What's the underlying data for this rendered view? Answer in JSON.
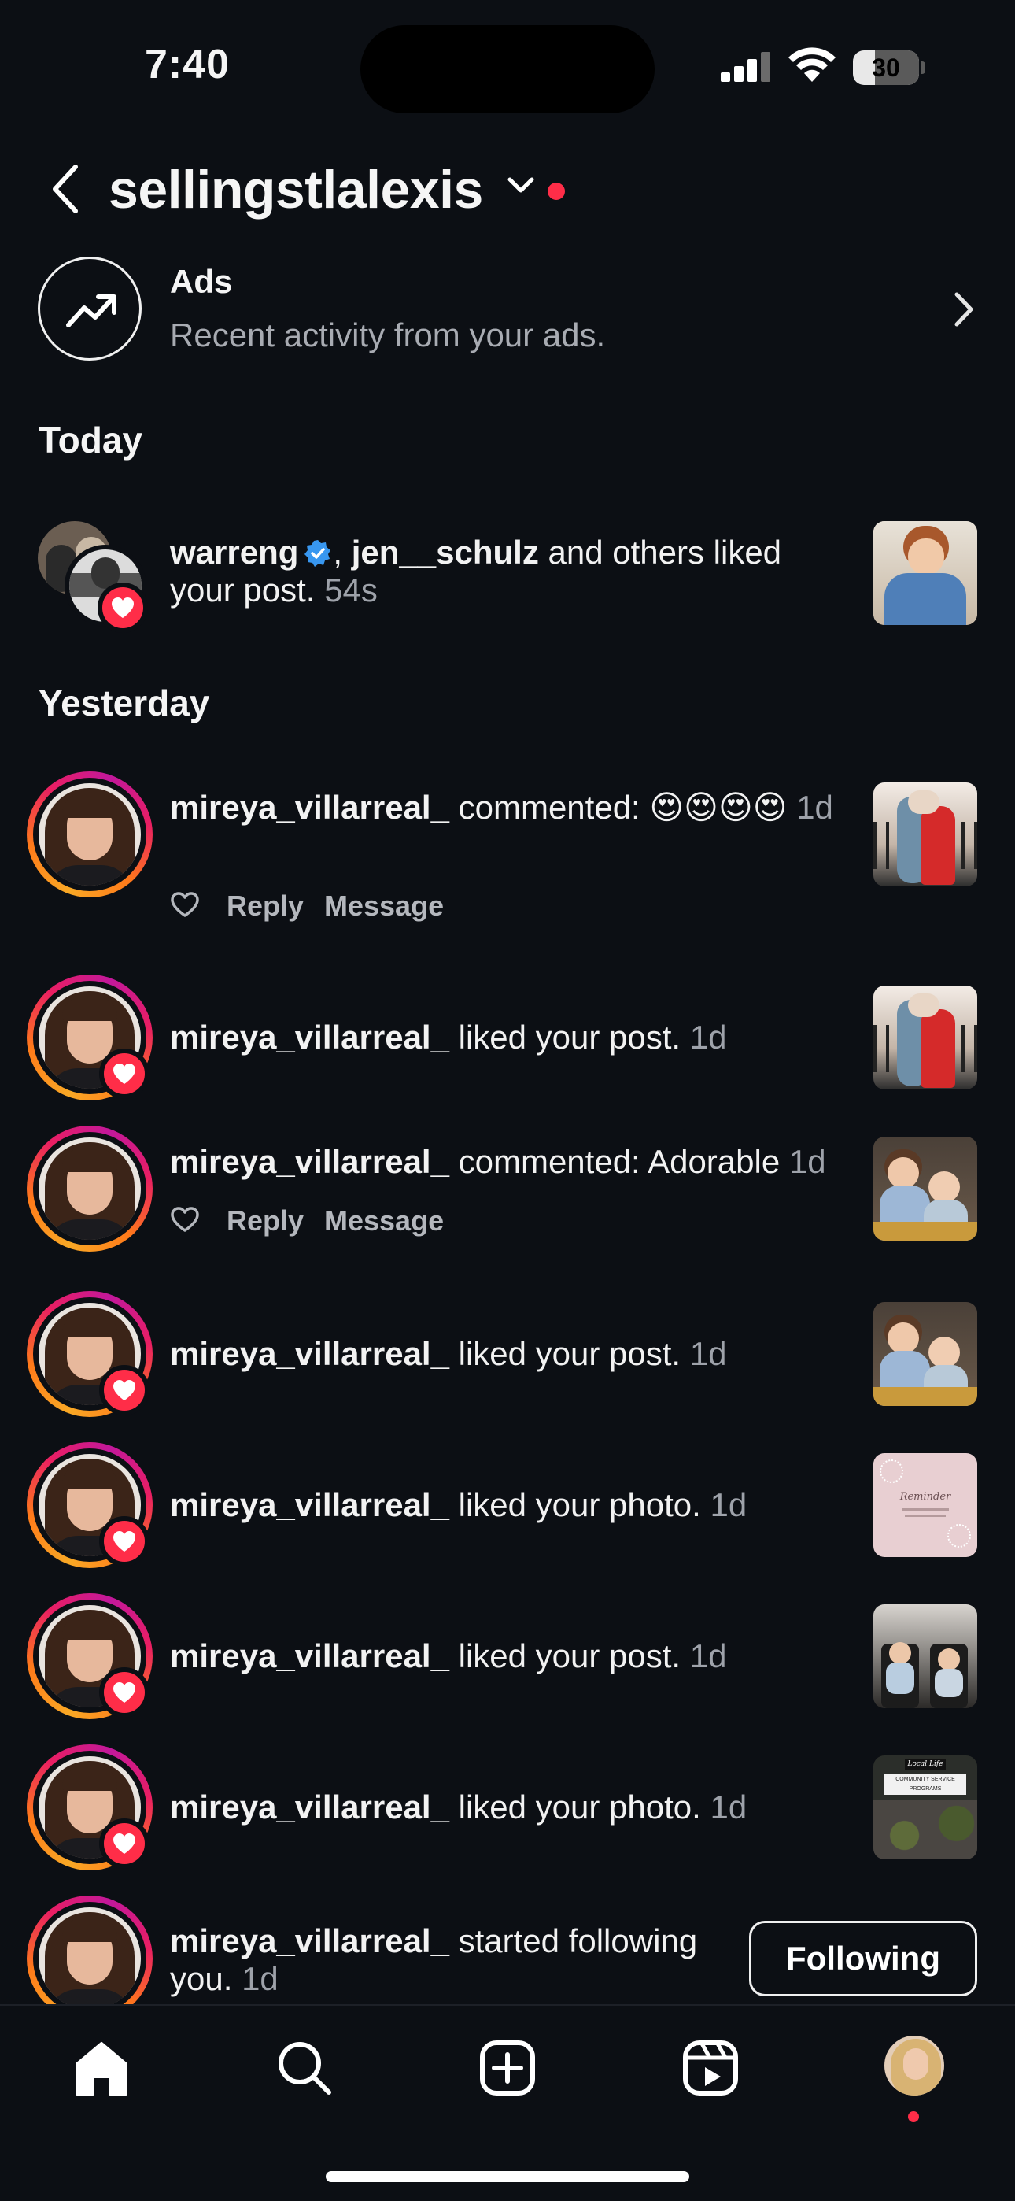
{
  "status_bar": {
    "time": "7:40",
    "battery": "30"
  },
  "header": {
    "account": "sellingstlalexis"
  },
  "ads": {
    "title": "Ads",
    "subtitle": "Recent activity from your ads."
  },
  "sections": {
    "today": "Today",
    "yesterday": "Yesterday"
  },
  "notifications": [
    {
      "users": [
        "warreng",
        "jen__schulz"
      ],
      "text": " and others liked your post.",
      "time": "54s",
      "thumb": "child-blue-shirt"
    },
    {
      "user": "mireya_villarreal_",
      "text": " commented: 😍😍😍😍",
      "time": "1d",
      "thumb": "couple-kiss"
    },
    {
      "user": "mireya_villarreal_",
      "text": " liked your post.",
      "time": "1d",
      "thumb": "couple-kiss"
    },
    {
      "user": "mireya_villarreal_",
      "text": " commented: Adorable",
      "time": "1d",
      "thumb": "kids-sitting"
    },
    {
      "user": "mireya_villarreal_",
      "text": " liked your post.",
      "time": "1d",
      "thumb": "kids-sitting"
    },
    {
      "user": "mireya_villarreal_",
      "text": " liked your photo.",
      "time": "1d",
      "thumb": "pink-card"
    },
    {
      "user": "mireya_villarreal_",
      "text": " liked your post.",
      "time": "1d",
      "thumb": "kids-chairs"
    },
    {
      "user": "mireya_villarreal_",
      "text": " liked your photo.",
      "time": "1d",
      "thumb": "local-life"
    },
    {
      "user": "mireya_villarreal_",
      "text": " started following you.",
      "time": "1d"
    }
  ],
  "comment_actions": {
    "reply": "Reply",
    "message": "Message"
  },
  "following_button": "Following",
  "thumb_texts": {
    "pink_card": "Reminder",
    "local_life_title": "Local Life",
    "local_life_sub": "COMMUNITY SERVICE PROGRAMS"
  },
  "colors": {
    "background": "#0c0f14",
    "accent_red": "#ff2d48",
    "verified_blue": "#3897f0"
  }
}
